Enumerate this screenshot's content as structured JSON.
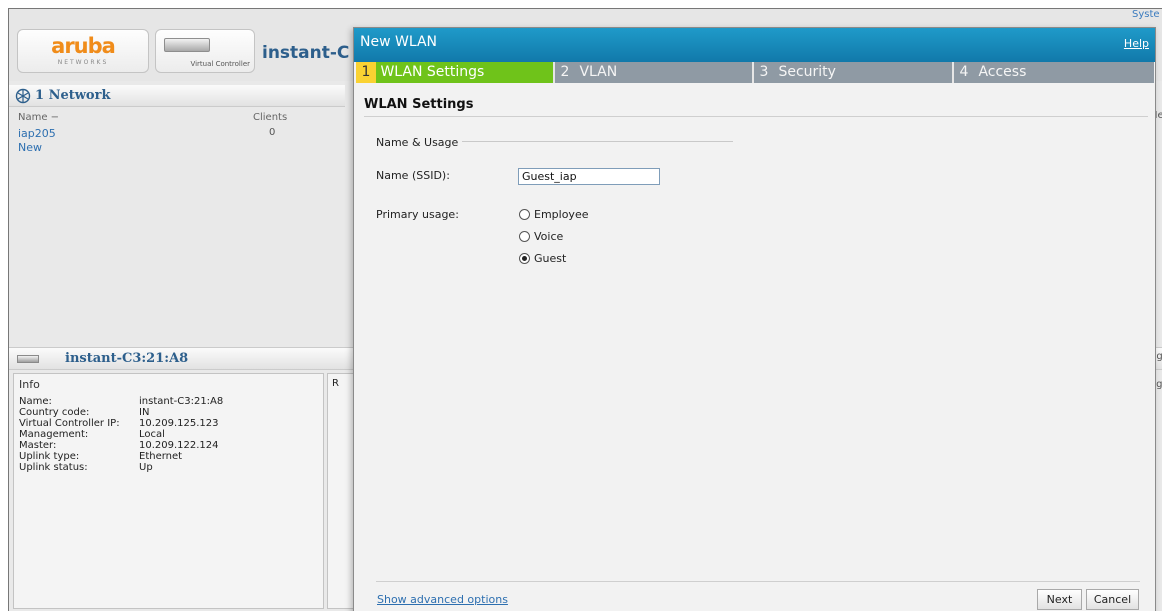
{
  "header": {
    "logo_text": "aruba",
    "logo_sub": "NETWORKS",
    "vc_label": "Virtual Controller",
    "instant_title": "instant-C",
    "system_link": "Syste"
  },
  "network_panel": {
    "title": "1 Network",
    "col_name": "Name −",
    "col_clients": "Clients",
    "rows": [
      {
        "name": "iap205",
        "clients": "0"
      },
      {
        "name": "New",
        "clients": ""
      }
    ]
  },
  "device_panel": {
    "title": "instant-C3:21:A8",
    "info_header": "Info",
    "r_fragment": "R",
    "info": [
      {
        "key": "Name:",
        "value": "instant-C3:21:A8"
      },
      {
        "key": "Country code:",
        "value": "IN"
      },
      {
        "key": "Virtual Controller IP:",
        "value": "10.209.125.123"
      },
      {
        "key": "Management:",
        "value": "Local"
      },
      {
        "key": "Master:",
        "value": "10.209.122.124"
      },
      {
        "key": "Uplink type:",
        "value": "Ethernet"
      },
      {
        "key": "Uplink status:",
        "value": "Up"
      }
    ]
  },
  "right_fragments": {
    "top": "Ne",
    "mid1": "ng",
    "mid2": "ag"
  },
  "dialog": {
    "title": "New WLAN",
    "help": "Help",
    "steps": [
      {
        "num": "1",
        "label": "WLAN Settings"
      },
      {
        "num": "2",
        "label": "VLAN"
      },
      {
        "num": "3",
        "label": "Security"
      },
      {
        "num": "4",
        "label": "Access"
      }
    ],
    "section_title": "WLAN Settings",
    "group_label": "Name & Usage",
    "ssid_label": "Name (SSID):",
    "ssid_value": "Guest_iap",
    "usage_label": "Primary usage:",
    "usage_options": [
      "Employee",
      "Voice",
      "Guest"
    ],
    "selected_usage": "Guest",
    "advanced_link": "Show advanced options",
    "next_label": "Next",
    "cancel_label": "Cancel"
  },
  "colors": {
    "header_blue": "#1588bd",
    "active_step": "#6fc31a",
    "step_number_bg": "#fad232",
    "step_bar": "#8f9aa4",
    "link_blue": "#2d6fb0",
    "logo_orange": "#f08c1a"
  }
}
